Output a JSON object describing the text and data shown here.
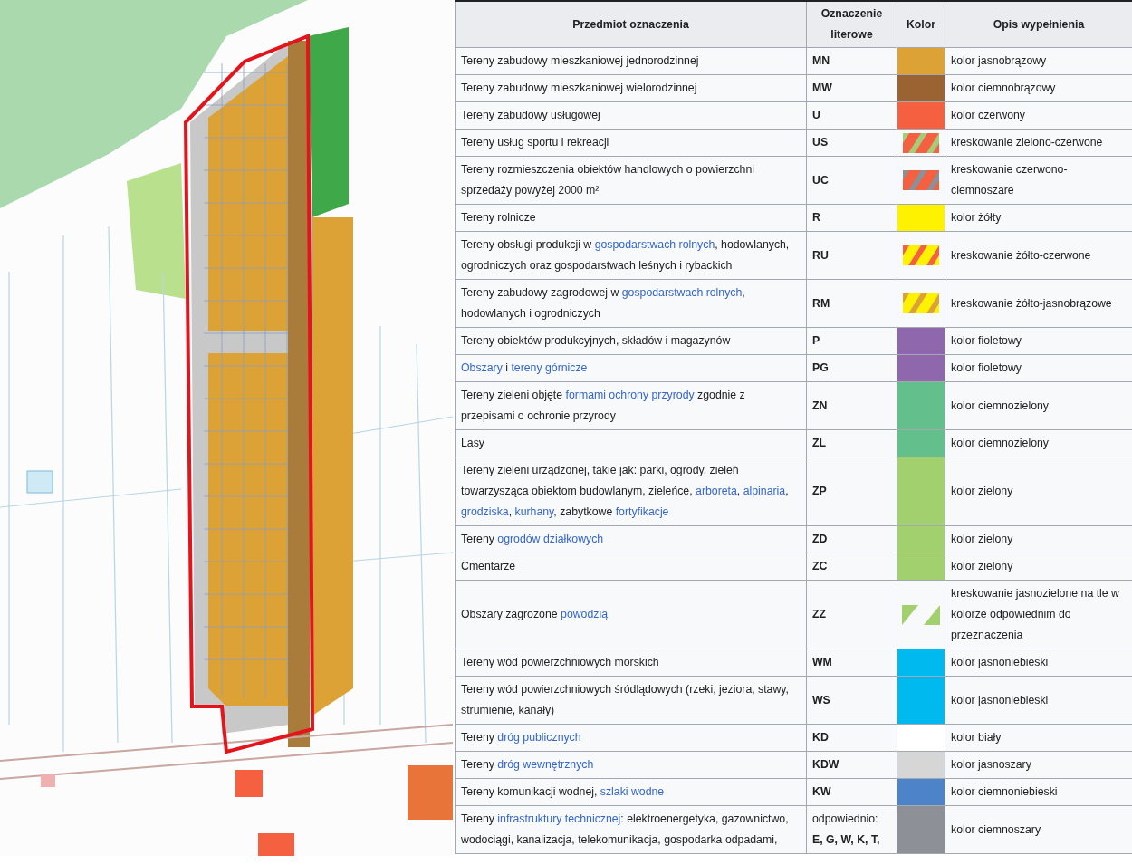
{
  "map": {
    "kind": "map"
  },
  "table": {
    "columns": [
      "Przedmiot oznaczenia",
      "Oznaczenie literowe",
      "Kolor",
      "Opis wypełnienia"
    ],
    "rows": [
      {
        "description": [
          {
            "text": "Tereny zabudowy mieszkaniowej jednorodzinnej",
            "link": false
          }
        ],
        "code": "MN",
        "swatch": {
          "kind": "solid",
          "color": "#dca236"
        },
        "fill": "kolor jasnobrązowy"
      },
      {
        "description": [
          {
            "text": "Tereny zabudowy mieszkaniowej wielorodzinnej",
            "link": false
          }
        ],
        "code": "MW",
        "swatch": {
          "kind": "solid",
          "color": "#9b6232"
        },
        "fill": "kolor ciemnobrązowy"
      },
      {
        "description": [
          {
            "text": "Tereny zabudowy usługowej",
            "link": false
          }
        ],
        "code": "U",
        "swatch": {
          "kind": "solid",
          "color": "#f46040"
        },
        "fill": "kolor czerwony"
      },
      {
        "description": [
          {
            "text": "Tereny usług sportu i rekreacji",
            "link": false
          }
        ],
        "code": "US",
        "swatch": {
          "kind": "hatch",
          "stripes": [
            {
              "color": "#f46040"
            },
            {
              "color": "#a6cc7a"
            }
          ]
        },
        "fill": "kreskowanie zielono-czerwone"
      },
      {
        "description": [
          {
            "text": "Tereny rozmieszczenia obiektów handlowych o powierzchni sprzedaży powyżej 2000 m²",
            "link": false
          }
        ],
        "code": "UC",
        "swatch": {
          "kind": "hatch",
          "stripes": [
            {
              "color": "#f46040"
            },
            {
              "color": "#8e9097"
            }
          ]
        },
        "fill": "kreskowanie czerwono-ciemnoszare"
      },
      {
        "description": [
          {
            "text": "Tereny rolnicze",
            "link": false
          }
        ],
        "code": "R",
        "swatch": {
          "kind": "solid",
          "color": "#fff200"
        },
        "fill": "kolor żółty"
      },
      {
        "description": [
          {
            "text": "Tereny obsługi produkcji w ",
            "link": false
          },
          {
            "text": "gospodarstwach rolnych",
            "link": true
          },
          {
            "text": ", hodowlanych, ogrodniczych oraz gospodarstwach leśnych i rybackich",
            "link": false
          }
        ],
        "code": "RU",
        "swatch": {
          "kind": "hatch",
          "stripes": [
            {
              "color": "#fff200"
            },
            {
              "color": "#f46040"
            }
          ]
        },
        "fill": "kreskowanie żółto-czerwone"
      },
      {
        "description": [
          {
            "text": "Tereny zabudowy zagrodowej w ",
            "link": false
          },
          {
            "text": "gospodarstwach rolnych",
            "link": true
          },
          {
            "text": ", hodowlanych i ogrodniczych",
            "link": false
          }
        ],
        "code": "RM",
        "swatch": {
          "kind": "hatch",
          "stripes": [
            {
              "color": "#fff200"
            },
            {
              "color": "#dca236"
            }
          ]
        },
        "fill": "kreskowanie żółto-jasnobrązowe"
      },
      {
        "description": [
          {
            "text": "Tereny obiektów produkcyjnych, składów i magazynów",
            "link": false
          }
        ],
        "code": "P",
        "swatch": {
          "kind": "solid",
          "color": "#8f67ad"
        },
        "fill": "kolor fioletowy"
      },
      {
        "description": [
          {
            "text": "Obszary",
            "link": true
          },
          {
            "text": " i ",
            "link": false
          },
          {
            "text": "tereny górnicze",
            "link": true
          }
        ],
        "code": "PG",
        "swatch": {
          "kind": "solid",
          "color": "#8f67ad"
        },
        "fill": "kolor fioletowy"
      },
      {
        "description": [
          {
            "text": "Tereny zieleni objęte ",
            "link": false
          },
          {
            "text": "formami ochrony przyrody",
            "link": true
          },
          {
            "text": " zgodnie z przepisami o ochronie przyrody",
            "link": false
          }
        ],
        "code": "ZN",
        "swatch": {
          "kind": "solid",
          "color": "#63c08c"
        },
        "fill": "kolor ciemnozielony"
      },
      {
        "description": [
          {
            "text": "Lasy",
            "link": false
          }
        ],
        "code": "ZL",
        "swatch": {
          "kind": "solid",
          "color": "#63c08c"
        },
        "fill": "kolor ciemnozielony"
      },
      {
        "description": [
          {
            "text": "Tereny zieleni urządzonej, takie jak: parki, ogrody, zieleń towarzysząca obiektom budowlanym, zieleńce, ",
            "link": false
          },
          {
            "text": "arboreta",
            "link": true
          },
          {
            "text": ", ",
            "link": false
          },
          {
            "text": "alpinaria",
            "link": true
          },
          {
            "text": ", ",
            "link": false
          },
          {
            "text": "grodziska",
            "link": true
          },
          {
            "text": ", ",
            "link": false
          },
          {
            "text": "kurhany",
            "link": true
          },
          {
            "text": ", zabytkowe ",
            "link": false
          },
          {
            "text": "fortyfikacje",
            "link": true
          }
        ],
        "code": "ZP",
        "swatch": {
          "kind": "solid",
          "color": "#a2d06e"
        },
        "fill": "kolor zielony"
      },
      {
        "description": [
          {
            "text": "Tereny ",
            "link": false
          },
          {
            "text": "ogrodów działkowych",
            "link": true
          }
        ],
        "code": "ZD",
        "swatch": {
          "kind": "solid",
          "color": "#a2d06e"
        },
        "fill": "kolor zielony"
      },
      {
        "description": [
          {
            "text": "Cmentarze",
            "link": false
          }
        ],
        "code": "ZC",
        "swatch": {
          "kind": "solid",
          "color": "#a2d06e"
        },
        "fill": "kolor zielony"
      },
      {
        "description": [
          {
            "text": "Obszary zagrożone ",
            "link": false
          },
          {
            "text": "powodzią",
            "link": true
          }
        ],
        "code": "ZZ",
        "swatch": {
          "kind": "triangles",
          "color": "#a2d06e"
        },
        "fill": "kreskowanie jasnozielone na tle w kolorze odpowiednim do przeznaczenia"
      },
      {
        "description": [
          {
            "text": "Tereny wód powierzchniowych morskich",
            "link": false
          }
        ],
        "code": "WM",
        "swatch": {
          "kind": "solid",
          "color": "#00b9ef"
        },
        "fill": "kolor jasnoniebieski"
      },
      {
        "description": [
          {
            "text": "Tereny wód powierzchniowych śródlądowych (rzeki, jeziora, stawy, strumienie, kanały)",
            "link": false
          }
        ],
        "code": "WS",
        "swatch": {
          "kind": "solid",
          "color": "#00b9ef"
        },
        "fill": "kolor jasnoniebieski"
      },
      {
        "description": [
          {
            "text": "Tereny ",
            "link": false
          },
          {
            "text": "dróg publicznych",
            "link": true
          }
        ],
        "code": "KD",
        "swatch": {
          "kind": "solid",
          "color": "#ffffff"
        },
        "fill": "kolor biały"
      },
      {
        "description": [
          {
            "text": "Tereny ",
            "link": false
          },
          {
            "text": "dróg wewnętrznych",
            "link": true
          }
        ],
        "code": "KDW",
        "swatch": {
          "kind": "solid",
          "color": "#d6d6d6"
        },
        "fill": "kolor jasnoszary"
      },
      {
        "description": [
          {
            "text": "Tereny komunikacji wodnej, ",
            "link": false
          },
          {
            "text": "szlaki wodne",
            "link": true
          }
        ],
        "code": "KW",
        "swatch": {
          "kind": "solid",
          "color": "#4d83c8"
        },
        "fill": "kolor ciemnoniebieski"
      },
      {
        "description": [
          {
            "text": "Tereny ",
            "link": false
          },
          {
            "text": "infrastruktury technicznej",
            "link": true
          },
          {
            "text": ": elektroenergetyka, gazownictwo, wodociągi, kanalizacja, telekomunikacja, gospodarka odpadami,",
            "link": false
          }
        ],
        "code_note": "odpowiednio:",
        "code": "E, G, W, K, T,",
        "swatch": {
          "kind": "solid",
          "color": "#8e9097"
        },
        "fill": "kolor ciemnoszary"
      }
    ]
  }
}
